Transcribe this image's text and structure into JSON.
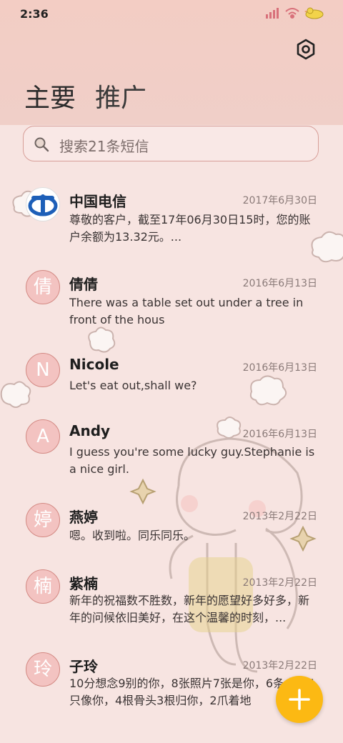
{
  "status_bar": {
    "time": "2:36"
  },
  "header": {
    "tabs": [
      {
        "label": "主要",
        "active": true
      },
      {
        "label": "推广",
        "active": false
      }
    ]
  },
  "search": {
    "placeholder": "搜索21条短信"
  },
  "messages": [
    {
      "sender": "中国电信",
      "date": "2017年6月30日",
      "preview": "尊敬的客户，截至17年06月30日15时，您的账户余额为13.32元。...",
      "avatar": ""
    },
    {
      "sender": "倩倩",
      "date": "2016年6月13日",
      "preview": "There was a table set out under a tree in front of the hous",
      "avatar": "倩"
    },
    {
      "sender": "Nicole",
      "date": "2016年6月13日",
      "preview": "Let's eat out,shall we?",
      "avatar": "N"
    },
    {
      "sender": "Andy",
      "date": "2016年6月13日",
      "preview": "I guess you're some lucky guy.Stephanie is a nice girl.",
      "avatar": "A"
    },
    {
      "sender": "燕婷",
      "date": "2013年2月22日",
      "preview": "嗯。收到啦。同乐同乐。",
      "avatar": "婷"
    },
    {
      "sender": "紫楠",
      "date": "2013年2月22日",
      "preview": "新年的祝福数不胜数，新年的愿望好多好多，新年的问候依旧美好，在这个温馨的时刻，...",
      "avatar": "楠"
    },
    {
      "sender": "子玲",
      "date": "2013年2月22日",
      "preview": "10分想念9别的你，8张照片7张是你，6条小狗5只像你，4根骨头3根归你，2爪着地",
      "avatar": "玲"
    }
  ],
  "fab": {
    "icon": "plus-icon"
  },
  "colors": {
    "accent": "#fcb913",
    "avatar_bg": "#f3c3c1",
    "header_bg": "#f3cdc4"
  }
}
